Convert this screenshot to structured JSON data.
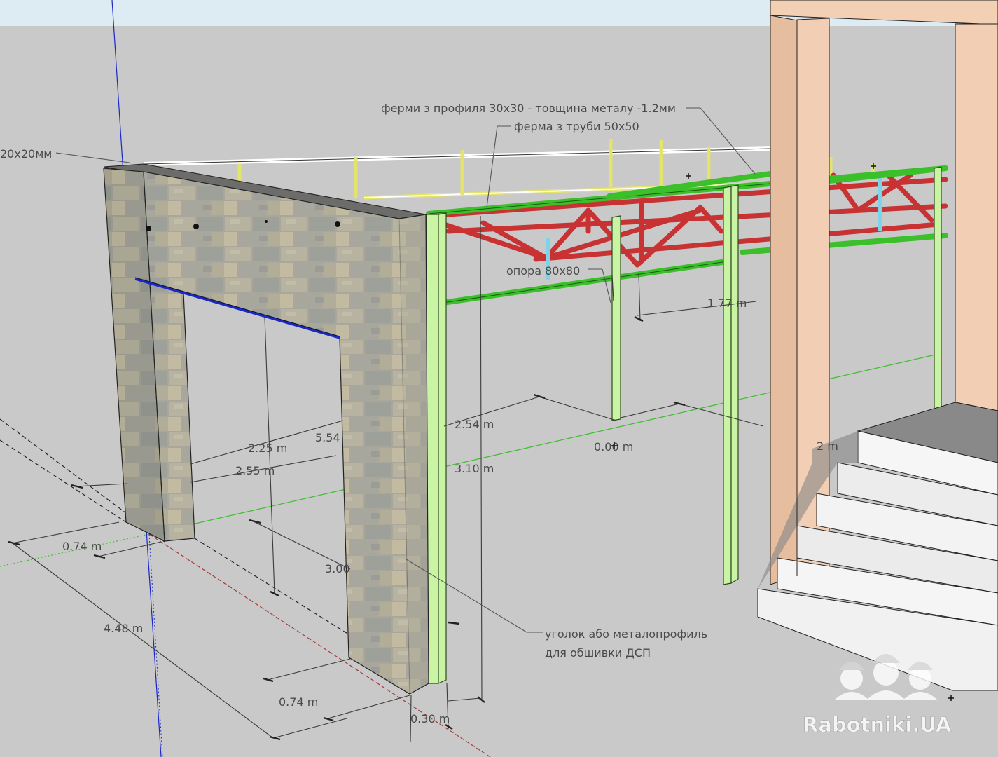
{
  "annotations": {
    "truss_profile": "ферми з профиля 30х30 - товщина металу -1.2мм",
    "truss_pipe": "ферма з труби 50х50",
    "corner_profile": "20х20мм",
    "support": "опора 80х80",
    "angle_line1": "уголок або металопрофиль",
    "angle_line2": "для обшивки ДСП"
  },
  "dimensions": {
    "d_177": "1.77 m",
    "d_254": "2.54 m",
    "d_000": "0.00 m",
    "d_225": "2.25 m",
    "d_554": "5.54",
    "d_255": "2.55 m",
    "d_310": "3.10 m",
    "d_074a": "0.74 m",
    "d_300": "3.00",
    "d_448": "4.48 m",
    "d_074b": "0.74 m",
    "d_030": "0.30 m",
    "d_2m": "2 m"
  },
  "watermark": "Rabotniki.UA",
  "colors": {
    "ground": "#c9c9c9",
    "sky": "#ddebf3",
    "frame_green": "#3bbf2a",
    "column_light_green": "#c8f4a3",
    "truss_red": "#c83232",
    "rail_yellow": "#e5e46a",
    "pillar_peach": "#f2cfb4",
    "axis_blue": "#1a28c8",
    "axis_green": "#3bbf2a",
    "axis_red": "#a83a3a"
  }
}
